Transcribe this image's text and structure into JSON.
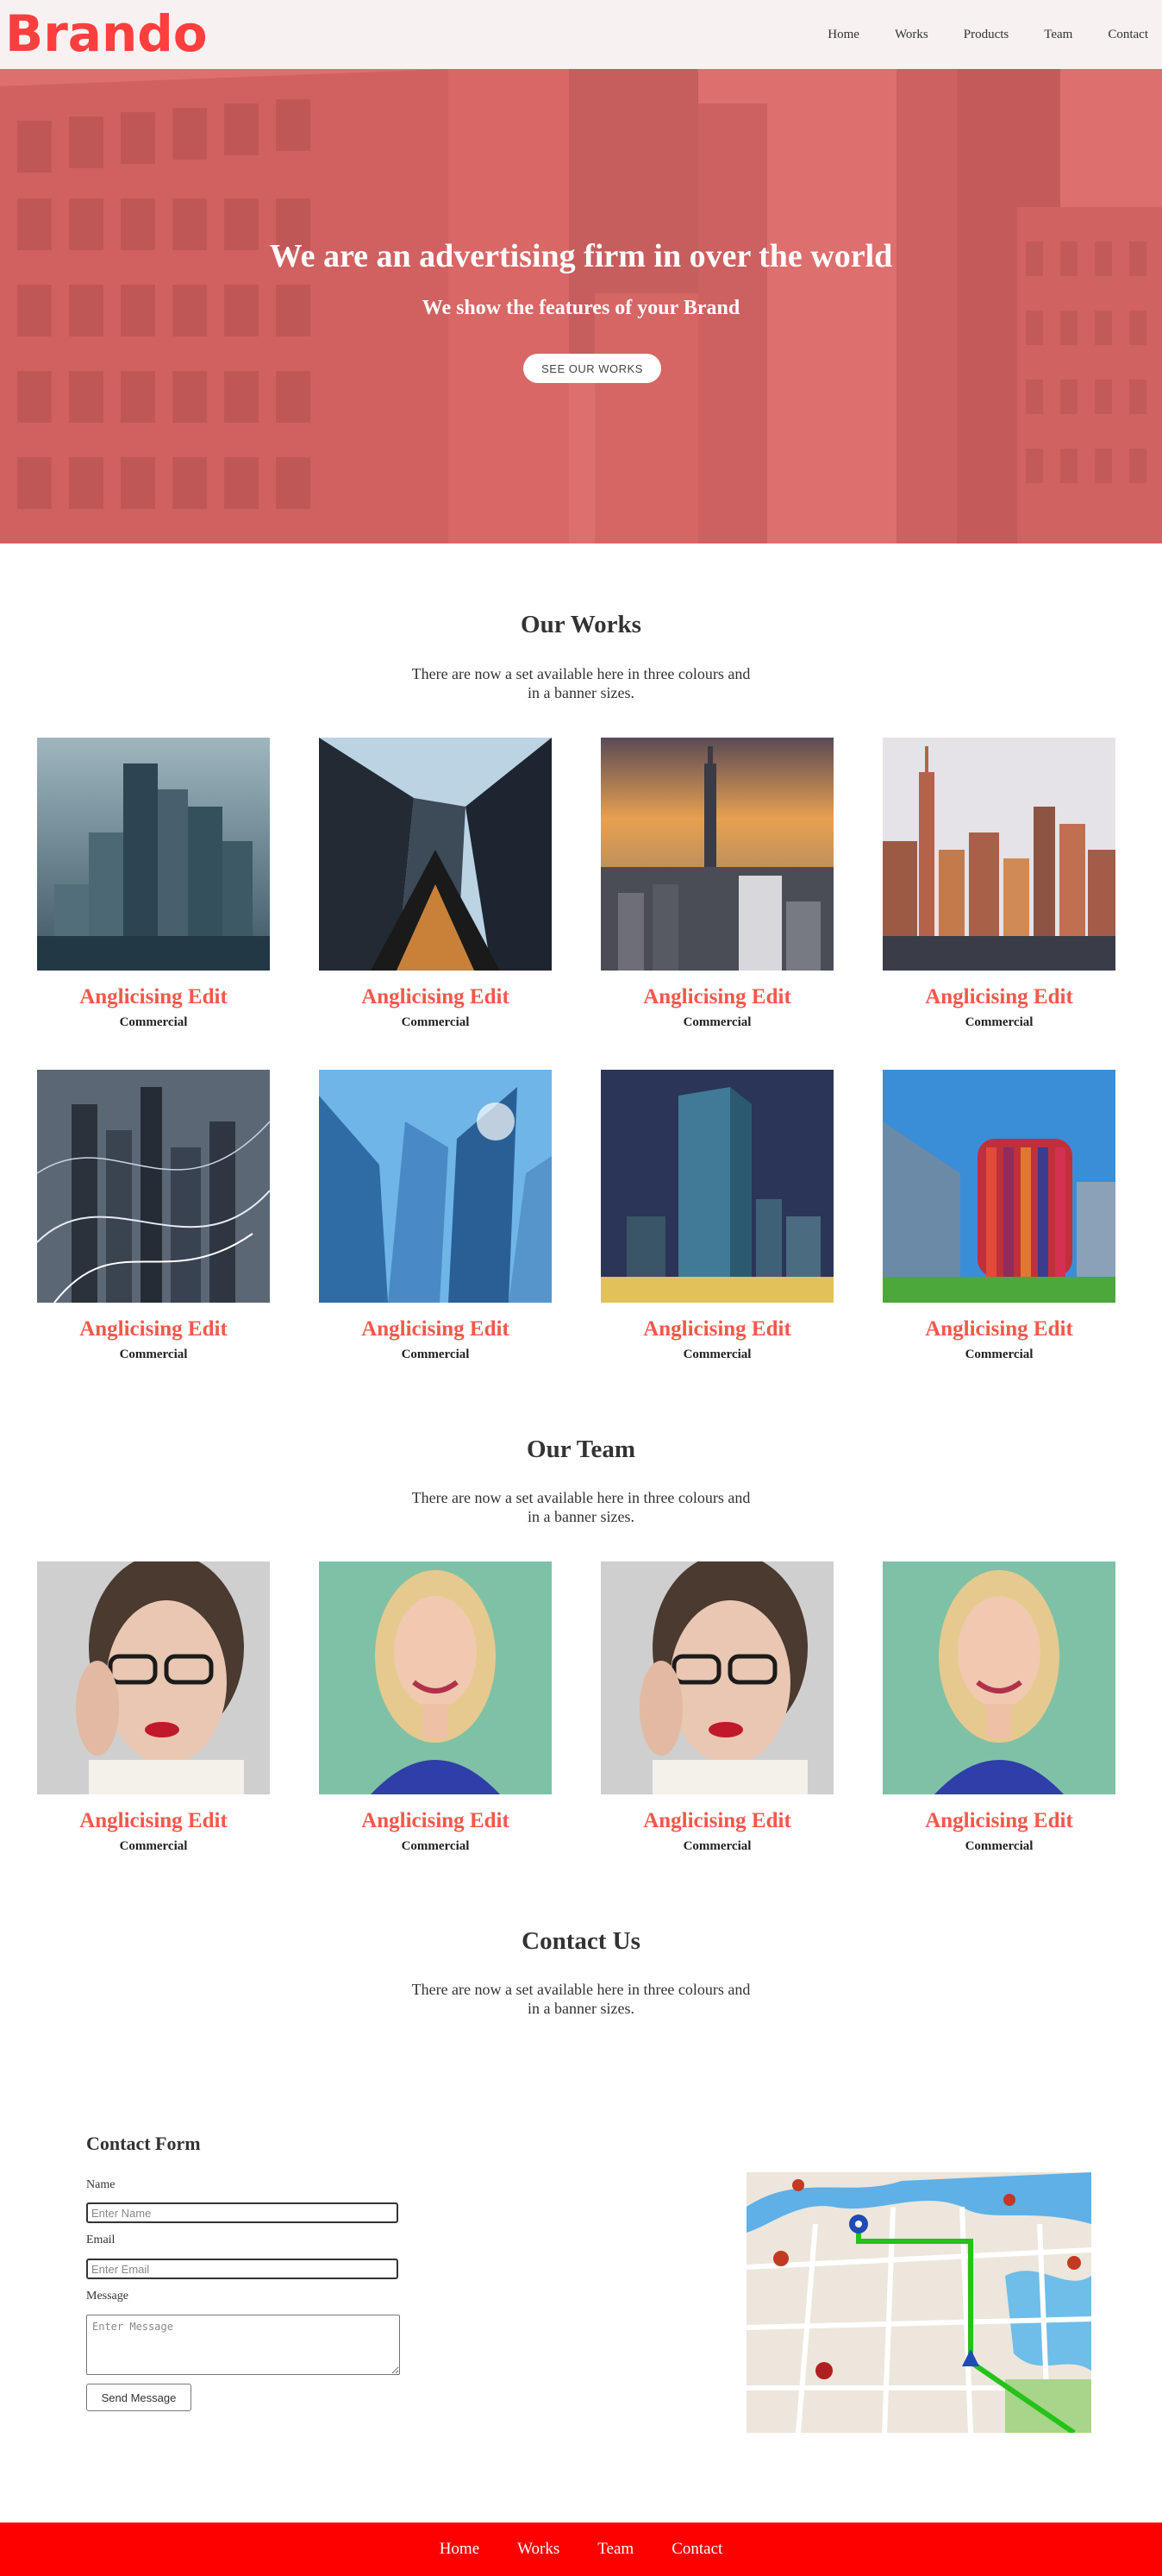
{
  "brand": {
    "logo": "Brando",
    "color": "#ff3e3e"
  },
  "nav": {
    "items": [
      "Home",
      "Works",
      "Products",
      "Team",
      "Contact"
    ]
  },
  "hero": {
    "title": "We are an advertising firm in over the world",
    "subtitle": "We show the features of your Brand",
    "button": "SEE OUR WORKS",
    "overlay_color": "#e06a67"
  },
  "works": {
    "title": "Our Works",
    "description": "There are now a set available here in three colours and in a banner sizes.",
    "cards": [
      {
        "title": "Anglicising Edit",
        "subtitle": "Commercial",
        "image": "skyscrapers-foggy"
      },
      {
        "title": "Anglicising Edit",
        "subtitle": "Commercial",
        "image": "skyscrapers-looking-up"
      },
      {
        "title": "Anglicising Edit",
        "subtitle": "Commercial",
        "image": "city-sunset-aerial"
      },
      {
        "title": "Anglicising Edit",
        "subtitle": "Commercial",
        "image": "skyline-waterfront"
      },
      {
        "title": "Anglicising Edit",
        "subtitle": "Commercial",
        "image": "city-network-lights"
      },
      {
        "title": "Anglicising Edit",
        "subtitle": "Commercial",
        "image": "glass-towers-sky"
      },
      {
        "title": "Anglicising Edit",
        "subtitle": "Commercial",
        "image": "tower-at-night"
      },
      {
        "title": "Anglicising Edit",
        "subtitle": "Commercial",
        "image": "colorful-building"
      }
    ]
  },
  "team": {
    "title": "Our Team",
    "description": "There are now a set available here in three colours and in a banner sizes.",
    "cards": [
      {
        "title": "Anglicising Edit",
        "subtitle": "Commercial",
        "image": "woman-glasses"
      },
      {
        "title": "Anglicising Edit",
        "subtitle": "Commercial",
        "image": "woman-blonde-smiling"
      },
      {
        "title": "Anglicising Edit",
        "subtitle": "Commercial",
        "image": "woman-glasses"
      },
      {
        "title": "Anglicising Edit",
        "subtitle": "Commercial",
        "image": "woman-blonde-smiling"
      }
    ]
  },
  "contact": {
    "title": "Contact Us",
    "description": "There are now a set available here in three colours and in a banner sizes.",
    "form_title": "Contact Form",
    "name_label": "Name",
    "name_placeholder": "Enter Name",
    "email_label": "Email",
    "email_placeholder": "Enter Email",
    "message_label": "Message",
    "message_placeholder": "Enter Message",
    "send_button": "Send Message",
    "map_image": "city-map-with-route"
  },
  "footer": {
    "items": [
      "Home",
      "Works",
      "Team",
      "Contact"
    ],
    "background": "#fd0000"
  },
  "colors": {
    "accent_title": "#f4574a",
    "text": "#333333"
  }
}
